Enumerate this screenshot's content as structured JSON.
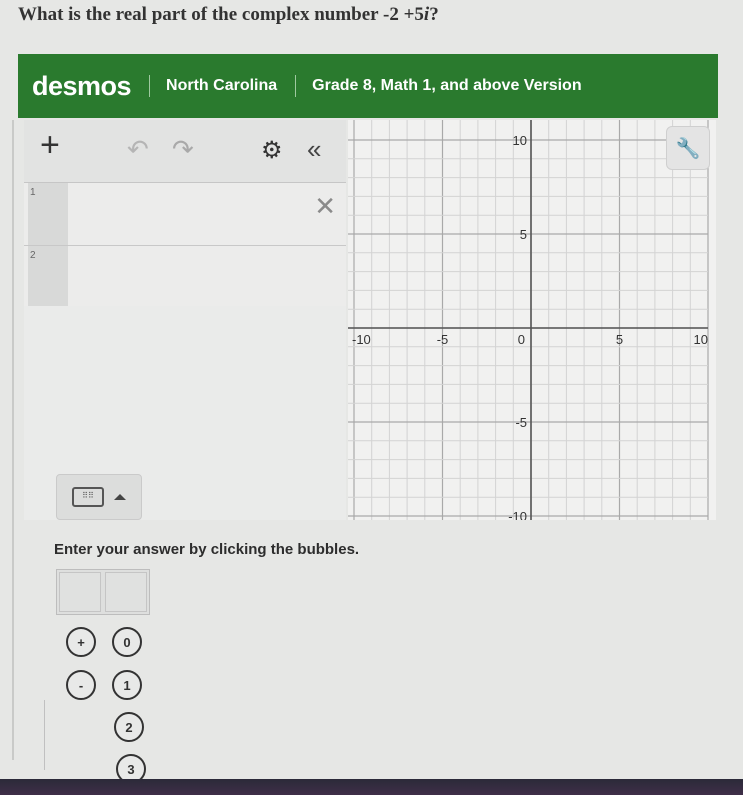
{
  "question": {
    "prefix": "What is the real part of the complex number -2 +5",
    "imag_unit": "i",
    "suffix": "?"
  },
  "banner": {
    "logo": "desmos",
    "state": "North Carolina",
    "version": "Grade 8, Math 1, and above Version",
    "color": "#2a7a2e"
  },
  "toolbar": {
    "add_icon": "plus-icon",
    "undo_icon": "undo-icon",
    "redo_icon": "redo-icon",
    "settings_icon": "gear-icon",
    "collapse_icon": "double-chevron-left-icon"
  },
  "expressions": [
    {
      "number": "1",
      "value": ""
    },
    {
      "number": "2",
      "value": ""
    }
  ],
  "graph": {
    "x_ticks": [
      "-10",
      "-5",
      "0",
      "5",
      "10"
    ],
    "y_ticks": [
      "10",
      "5",
      "-5",
      "-10"
    ],
    "x_range": [
      -10,
      10
    ],
    "y_range": [
      -10,
      10
    ],
    "minor_step": 1,
    "major_step": 5,
    "settings_icon": "wrench-icon"
  },
  "keyboard_toggle": {
    "icon": "keyboard-icon",
    "caret": "caret-up-icon"
  },
  "instruction": "Enter your answer by clicking the bubbles.",
  "answer": {
    "boxes": [
      "",
      ""
    ]
  },
  "bubbles": {
    "signs": [
      "+",
      "-"
    ],
    "digits": [
      "0",
      "1",
      "2",
      "3"
    ]
  }
}
